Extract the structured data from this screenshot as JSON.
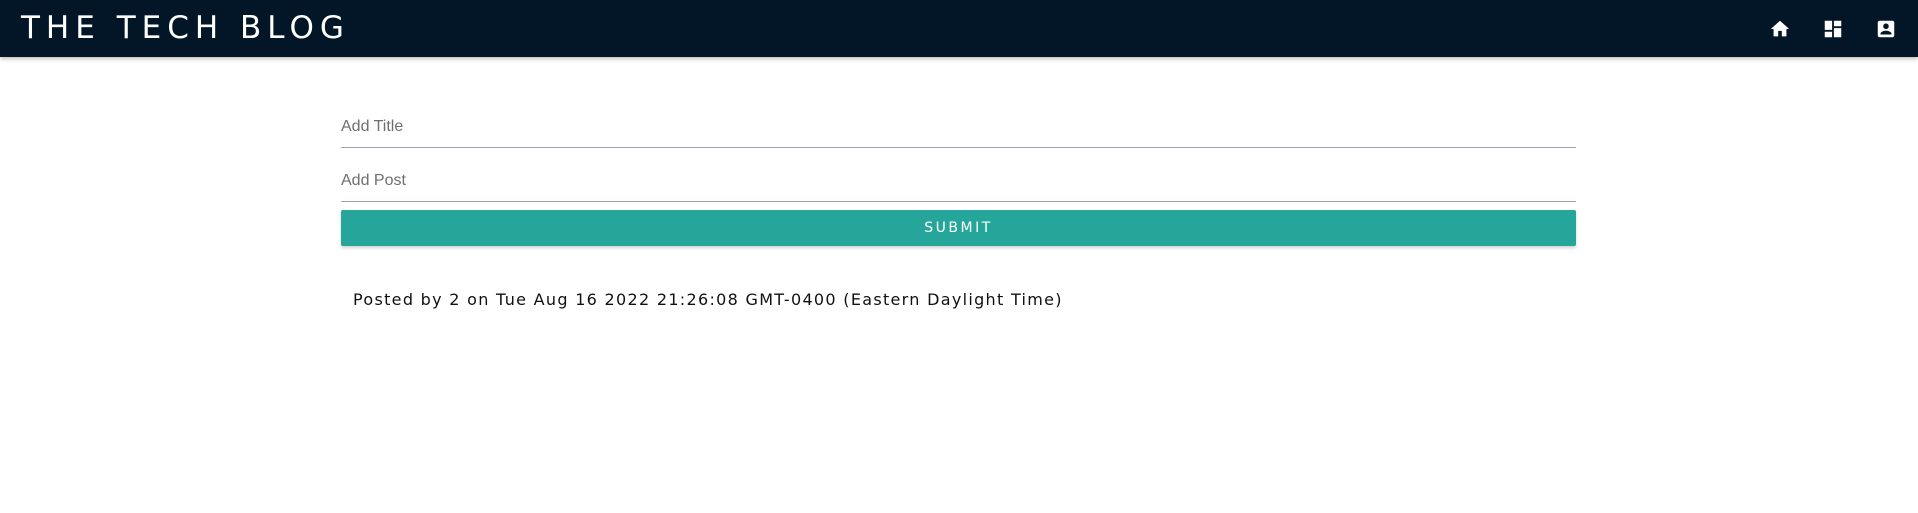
{
  "header": {
    "brand": "THE TECH BLOG",
    "background_color": "#021627",
    "icons": [
      {
        "name": "home-icon",
        "label": ""
      },
      {
        "name": "dashboard-icon",
        "label": ""
      },
      {
        "name": "account-box-icon",
        "label": ""
      }
    ]
  },
  "form": {
    "title_placeholder": "Add Title",
    "title_value": "",
    "post_placeholder": "Add Post",
    "post_value": "",
    "submit_label": "SUBMIT",
    "submit_color": "#26a69a"
  },
  "post": {
    "meta": "Posted by 2 on Tue Aug 16 2022 21:26:08 GMT-0400 (Eastern Daylight Time)"
  }
}
